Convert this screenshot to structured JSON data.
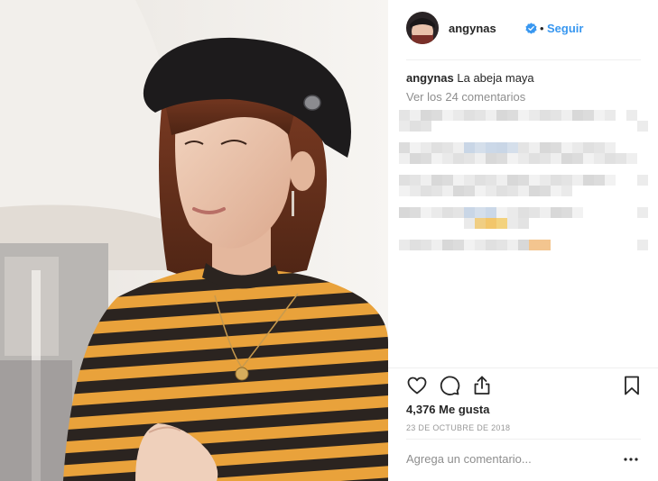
{
  "post": {
    "username": "angynas",
    "follow_label": "Seguir",
    "separator": "•",
    "verified_icon": "verified-badge-icon",
    "caption": {
      "username": "angynas",
      "text": "La abeja maya"
    },
    "view_comments_label": "Ver los 24 comentarios",
    "likes_label": "4,376 Me gusta",
    "date_label": "23 DE OCTUBRE DE 2018",
    "comment_placeholder": "Agrega un comentario...",
    "more_options_icon": "more-options-icon",
    "actions": [
      "heart-icon",
      "comment-icon",
      "share-icon",
      "bookmark-icon"
    ]
  },
  "colors": {
    "accent": "#3897f0",
    "text": "#262626",
    "muted": "#8e8e8e",
    "divider": "#efefef",
    "stripe_yellow": "#e9a23b",
    "stripe_dark": "#2b2420"
  }
}
